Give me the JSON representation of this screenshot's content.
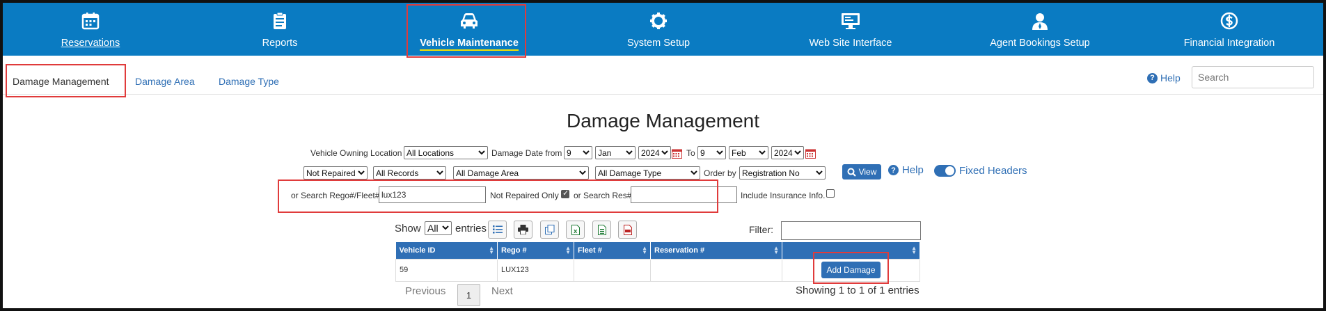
{
  "nav": [
    {
      "label": "Reservations",
      "icon": "calendar-icon"
    },
    {
      "label": "Reports",
      "icon": "clipboard-icon"
    },
    {
      "label": "Vehicle Maintenance",
      "icon": "car-icon"
    },
    {
      "label": "System Setup",
      "icon": "gear-icon"
    },
    {
      "label": "Web Site Interface",
      "icon": "monitor-icon"
    },
    {
      "label": "Agent Bookings Setup",
      "icon": "user-icon"
    },
    {
      "label": "Financial Integration",
      "icon": "money-icon"
    }
  ],
  "subnav": {
    "items": [
      "Damage Management",
      "Damage Area",
      "Damage Type"
    ],
    "help": "Help",
    "search_placeholder": "Search"
  },
  "title": "Damage Management",
  "filters": {
    "owning_location_label": "Vehicle Owning Location",
    "owning_location": "All Locations",
    "damage_date_label": "Damage Date from",
    "from_day": "9",
    "from_month": "Jan",
    "from_year": "2024",
    "to_label": "To",
    "to_day": "9",
    "to_month": "Feb",
    "to_year": "2024",
    "repair_status": "Not Repaired",
    "records": "All Records",
    "damage_area": "All Damage Area",
    "damage_type": "All Damage Type",
    "order_by_label": "Order by",
    "order_by": "Registration No",
    "view_label": "View",
    "help_label": "Help",
    "fixed_headers_label": "Fixed Headers",
    "search_rego_label": "or Search Rego#/Fleet#",
    "search_rego_value": "lux123",
    "not_repaired_only_label": "Not Repaired Only",
    "search_res_label": "or Search Res#",
    "search_res_value": "",
    "include_insurance_label": "Include Insurance Info."
  },
  "table_controls": {
    "show_label": "Show",
    "show_value": "All",
    "entries_label": "entries",
    "filter_label": "Filter:"
  },
  "table": {
    "columns": [
      "Vehicle ID",
      "Rego #",
      "Fleet #",
      "Reservation #",
      ""
    ],
    "rows": [
      {
        "vehicle_id": "59",
        "rego": "LUX123",
        "fleet": "",
        "reservation": "",
        "action": "Add Damage"
      }
    ]
  },
  "pagination": {
    "previous": "Previous",
    "page": "1",
    "next": "Next",
    "info": "Showing 1 to 1 of 1 entries"
  },
  "colors": {
    "nav_bg": "#0a7bc2",
    "accent": "#2f6fb5",
    "highlight_box": "#e03b3b"
  }
}
